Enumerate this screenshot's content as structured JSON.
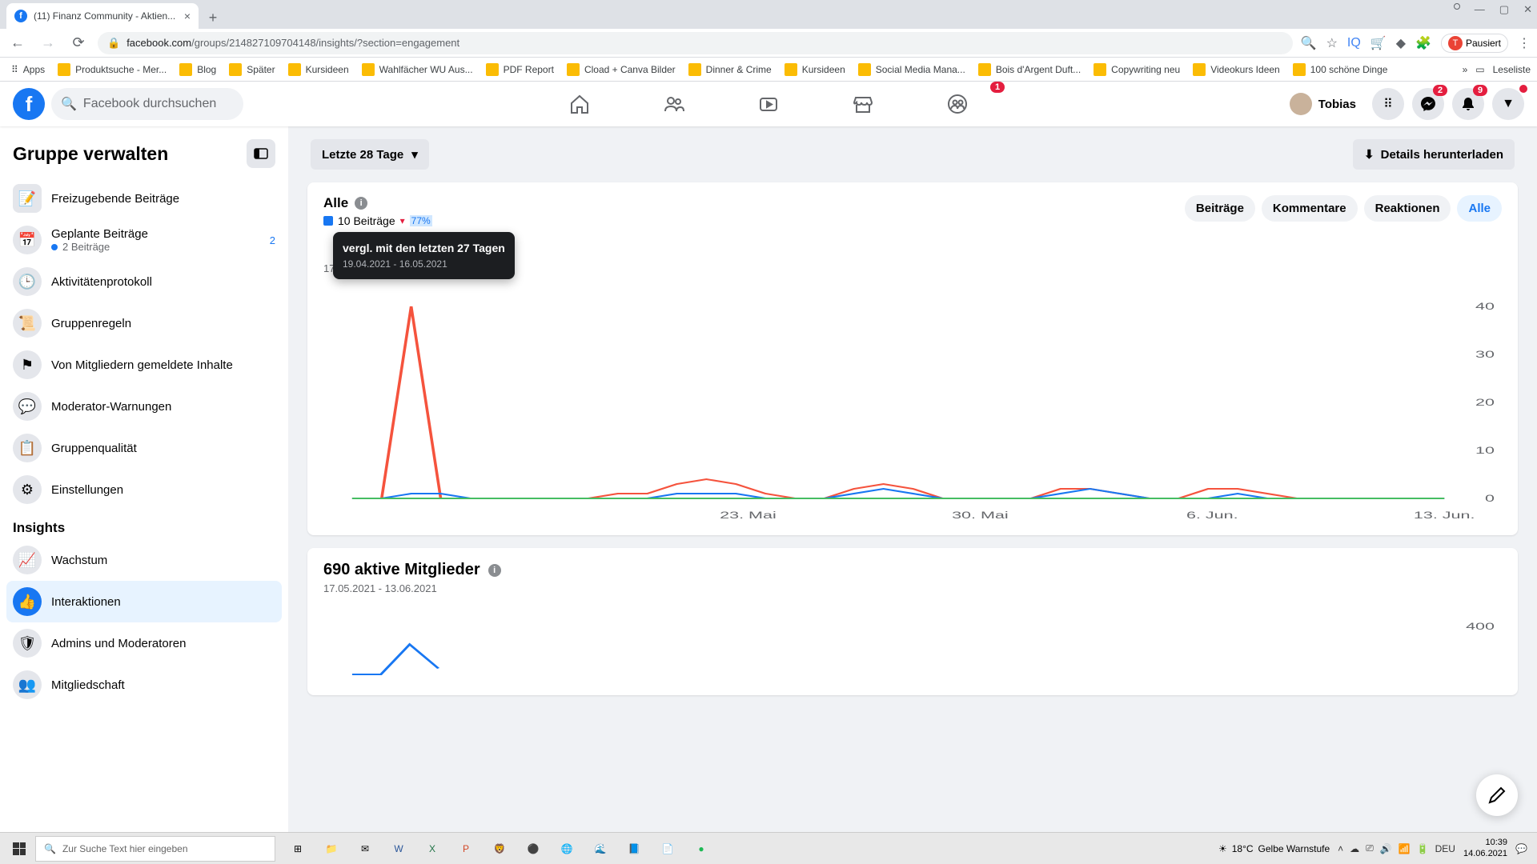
{
  "browser": {
    "tab_title": "(11) Finanz Community - Aktien...",
    "url_prefix": "facebook.com",
    "url_path": "/groups/214827109704148/insights/?section=engagement",
    "paused": "Pausiert",
    "bookmarks": [
      {
        "label": "Apps"
      },
      {
        "label": "Produktsuche - Mer..."
      },
      {
        "label": "Blog"
      },
      {
        "label": "Später"
      },
      {
        "label": "Kursideen"
      },
      {
        "label": "Wahlfächer WU Aus..."
      },
      {
        "label": "PDF Report"
      },
      {
        "label": "Cload + Canva Bilder"
      },
      {
        "label": "Dinner & Crime"
      },
      {
        "label": "Kursideen"
      },
      {
        "label": "Social Media Mana..."
      },
      {
        "label": "Bois d'Argent Duft..."
      },
      {
        "label": "Copywriting neu"
      },
      {
        "label": "Videokurs Ideen"
      },
      {
        "label": "100 schöne Dinge"
      }
    ],
    "reading_list": "Leseliste"
  },
  "fb_header": {
    "search_placeholder": "Facebook durchsuchen",
    "user_name": "Tobias",
    "badges": {
      "groups": "1",
      "messenger": "2",
      "notifications": "9"
    }
  },
  "sidebar": {
    "title": "Gruppe verwalten",
    "items_admin": [
      {
        "icon": "📝",
        "label": "Freizugebende Beiträge"
      },
      {
        "icon": "📅",
        "label": "Geplante Beiträge",
        "sub": "2 Beiträge",
        "count": "2"
      },
      {
        "icon": "🕒",
        "label": "Aktivitätenprotokoll"
      },
      {
        "icon": "📜",
        "label": "Gruppenregeln"
      },
      {
        "icon": "⚑",
        "label": "Von Mitgliedern gemeldete Inhalte"
      },
      {
        "icon": "💬",
        "label": "Moderator-Warnungen"
      },
      {
        "icon": "📋",
        "label": "Gruppenqualität"
      },
      {
        "icon": "⚙",
        "label": "Einstellungen"
      }
    ],
    "section_insights": "Insights",
    "items_insights": [
      {
        "icon": "📈",
        "label": "Wachstum"
      },
      {
        "icon": "👍",
        "label": "Interaktionen",
        "active": true
      },
      {
        "icon": "🛡",
        "label": "Admins und Moderatoren"
      },
      {
        "icon": "👥",
        "label": "Mitgliedschaft"
      }
    ]
  },
  "main": {
    "date_dropdown": "Letzte 28 Tage",
    "download_btn": "Details herunterladen",
    "card1": {
      "title": "Alle",
      "legend_posts": "10 Beiträge",
      "trend_pct": "77%",
      "date_range": "17.05.2021 - 13.06.2021",
      "pills": [
        "Beiträge",
        "Kommentare",
        "Reaktionen",
        "Alle"
      ],
      "active_pill": 3
    },
    "tooltip": {
      "title": "vergl. mit den letzten 27 Tagen",
      "date": "19.04.2021 - 16.05.2021"
    },
    "card2": {
      "title": "690 aktive Mitglieder",
      "date_range": "17.05.2021 - 13.06.2021"
    }
  },
  "chart_data": {
    "type": "line",
    "x_labels": [
      "23. Mai",
      "30. Mai",
      "6. Jun.",
      "13. Jun."
    ],
    "ylim": [
      0,
      40
    ],
    "y_ticks": [
      0,
      10,
      20,
      30,
      40
    ],
    "series": [
      {
        "name": "Reaktionen",
        "color": "#f5533d",
        "values": [
          0,
          0,
          40,
          0,
          0,
          0,
          0,
          0,
          0,
          1,
          1,
          3,
          4,
          3,
          1,
          0,
          0,
          2,
          3,
          2,
          0,
          0,
          0,
          0,
          2,
          2,
          1,
          0,
          0,
          2,
          2,
          1,
          0,
          0,
          0,
          0,
          0,
          0
        ]
      },
      {
        "name": "Beiträge",
        "color": "#1877f2",
        "values": [
          0,
          0,
          1,
          1,
          0,
          0,
          0,
          0,
          0,
          0,
          0,
          1,
          1,
          1,
          0,
          0,
          0,
          1,
          2,
          1,
          0,
          0,
          0,
          0,
          1,
          2,
          1,
          0,
          0,
          0,
          1,
          0,
          0,
          0,
          0,
          0,
          0,
          0
        ]
      },
      {
        "name": "Kommentare",
        "color": "#45bd62",
        "values": [
          0,
          0,
          0,
          0,
          0,
          0,
          0,
          0,
          0,
          0,
          0,
          0,
          0,
          0,
          0,
          0,
          0,
          0,
          0,
          0,
          0,
          0,
          0,
          0,
          0,
          0,
          0,
          0,
          0,
          0,
          0,
          0,
          0,
          0,
          0,
          0,
          0,
          0
        ]
      }
    ]
  },
  "chart2_data": {
    "ylim": [
      0,
      400
    ],
    "y_ticks": [
      400
    ],
    "series": [
      {
        "name": "Aktive Mitglieder",
        "color": "#1877f2",
        "values": [
          0,
          0,
          250,
          50
        ]
      }
    ]
  },
  "taskbar": {
    "search_placeholder": "Zur Suche Text hier eingeben",
    "weather_temp": "18°C",
    "weather_desc": "Gelbe Warnstufe",
    "lang": "DEU",
    "time": "10:39",
    "date": "14.06.2021"
  }
}
